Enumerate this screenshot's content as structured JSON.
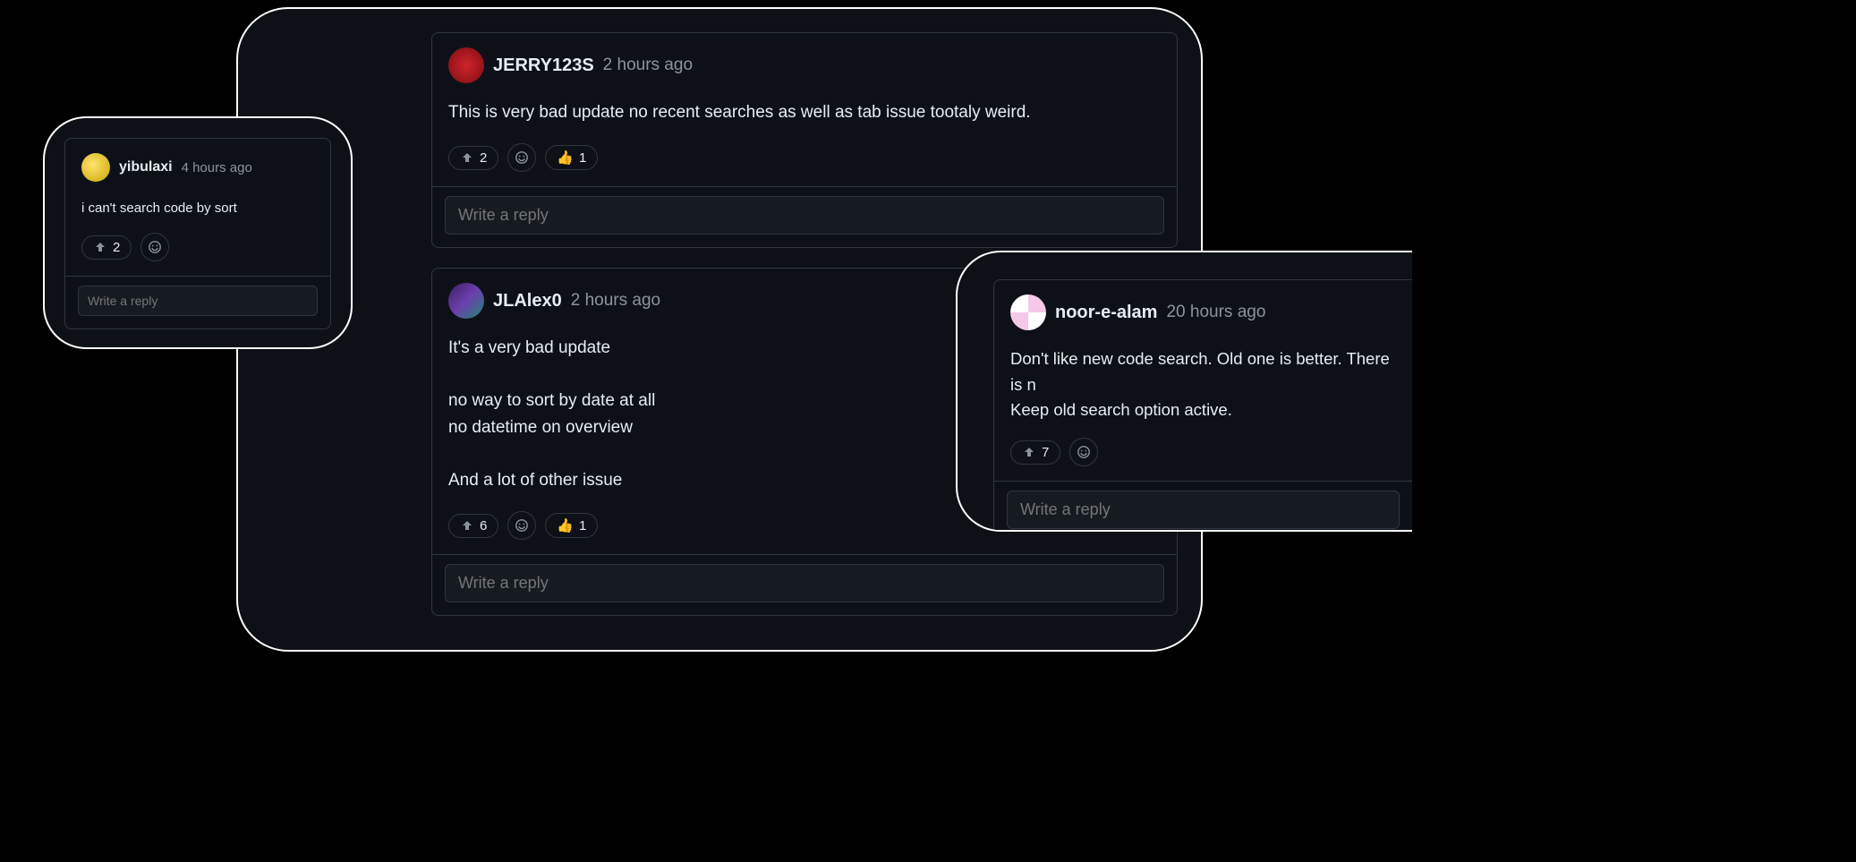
{
  "placeholders": {
    "reply": "Write a reply"
  },
  "cards": {
    "left": {
      "username": "yibulaxi",
      "timestamp": "4 hours ago",
      "content": "i can't search code by sort",
      "upvotes": "2"
    },
    "center": {
      "comments": [
        {
          "username": "JERRY123S",
          "timestamp": "2 hours ago",
          "content": "This is very bad update no recent searches as well as tab issue tootaly weird.",
          "upvotes": "2",
          "thumbs": "1"
        },
        {
          "username": "JLAlex0",
          "timestamp": "2 hours ago",
          "content": "It's a very bad update\n\nno way to sort by date at all\nno datetime on overview\n\nAnd a lot of other issue",
          "upvotes": "6",
          "thumbs": "1"
        }
      ]
    },
    "right": {
      "username": "noor-e-alam",
      "timestamp": "20 hours ago",
      "content": "Don't like new code search. Old one is better. There is n\nKeep old search option active.",
      "upvotes": "7"
    }
  }
}
